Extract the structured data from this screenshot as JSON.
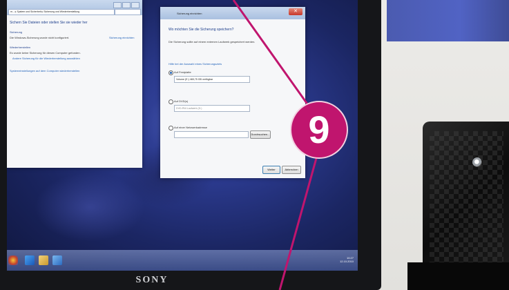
{
  "callout": {
    "number": "9",
    "color": "#c0156e"
  },
  "monitor": {
    "brand": "SONY"
  },
  "left_window": {
    "address_text": "m... ▸ System und Sicherheit ▸ Sicherung und Wiederherstellung",
    "search_placeholder": "Systemsteuerung durchsuchen",
    "heading": "Sichern Sie Dateien oder stellen Sie sie wieder her",
    "section_backup": "Sicherung",
    "backup_status": "Die Windows-Sicherung wurde nicht konfiguriert.",
    "setup_link": "Sicherung einrichten",
    "section_restore": "Wiederherstellen",
    "restore_text": "Es wurde keine Sicherung für diesen Computer gefunden.",
    "restore_link": "Andere Sicherung für die Wiederherstellung auswählen",
    "system_link": "Systemeinstellungen auf dem Computer wiederherstellen"
  },
  "dialog": {
    "title": "Sicherung einrichten",
    "question": "Wo möchten Sie die Sicherung speichern?",
    "description": "Die Sicherung sollte auf einem externen Laufwerk gespeichert werden.",
    "help_link": "Hilfe bei der Auswahl eines Sicherungsziels",
    "option_local": "Auf Festplatte",
    "local_value": "Volume (E:) 465,75 GB verfügbar",
    "option_dvd": "Auf DVD(s)",
    "dvd_value": "DVD-RW-Laufwerk (D:)",
    "option_network": "Auf einer Netzwerkadresse",
    "browse_label": "Durchsuchen...",
    "next_label": "Weiter",
    "cancel_label": "Abbrechen"
  },
  "taskbar": {
    "time": "10:27",
    "date": "12.10.2010"
  },
  "icons": [
    "ie-icon",
    "explorer-icon",
    "control-panel-icon",
    "start-icon",
    "drive-logo-icon"
  ]
}
